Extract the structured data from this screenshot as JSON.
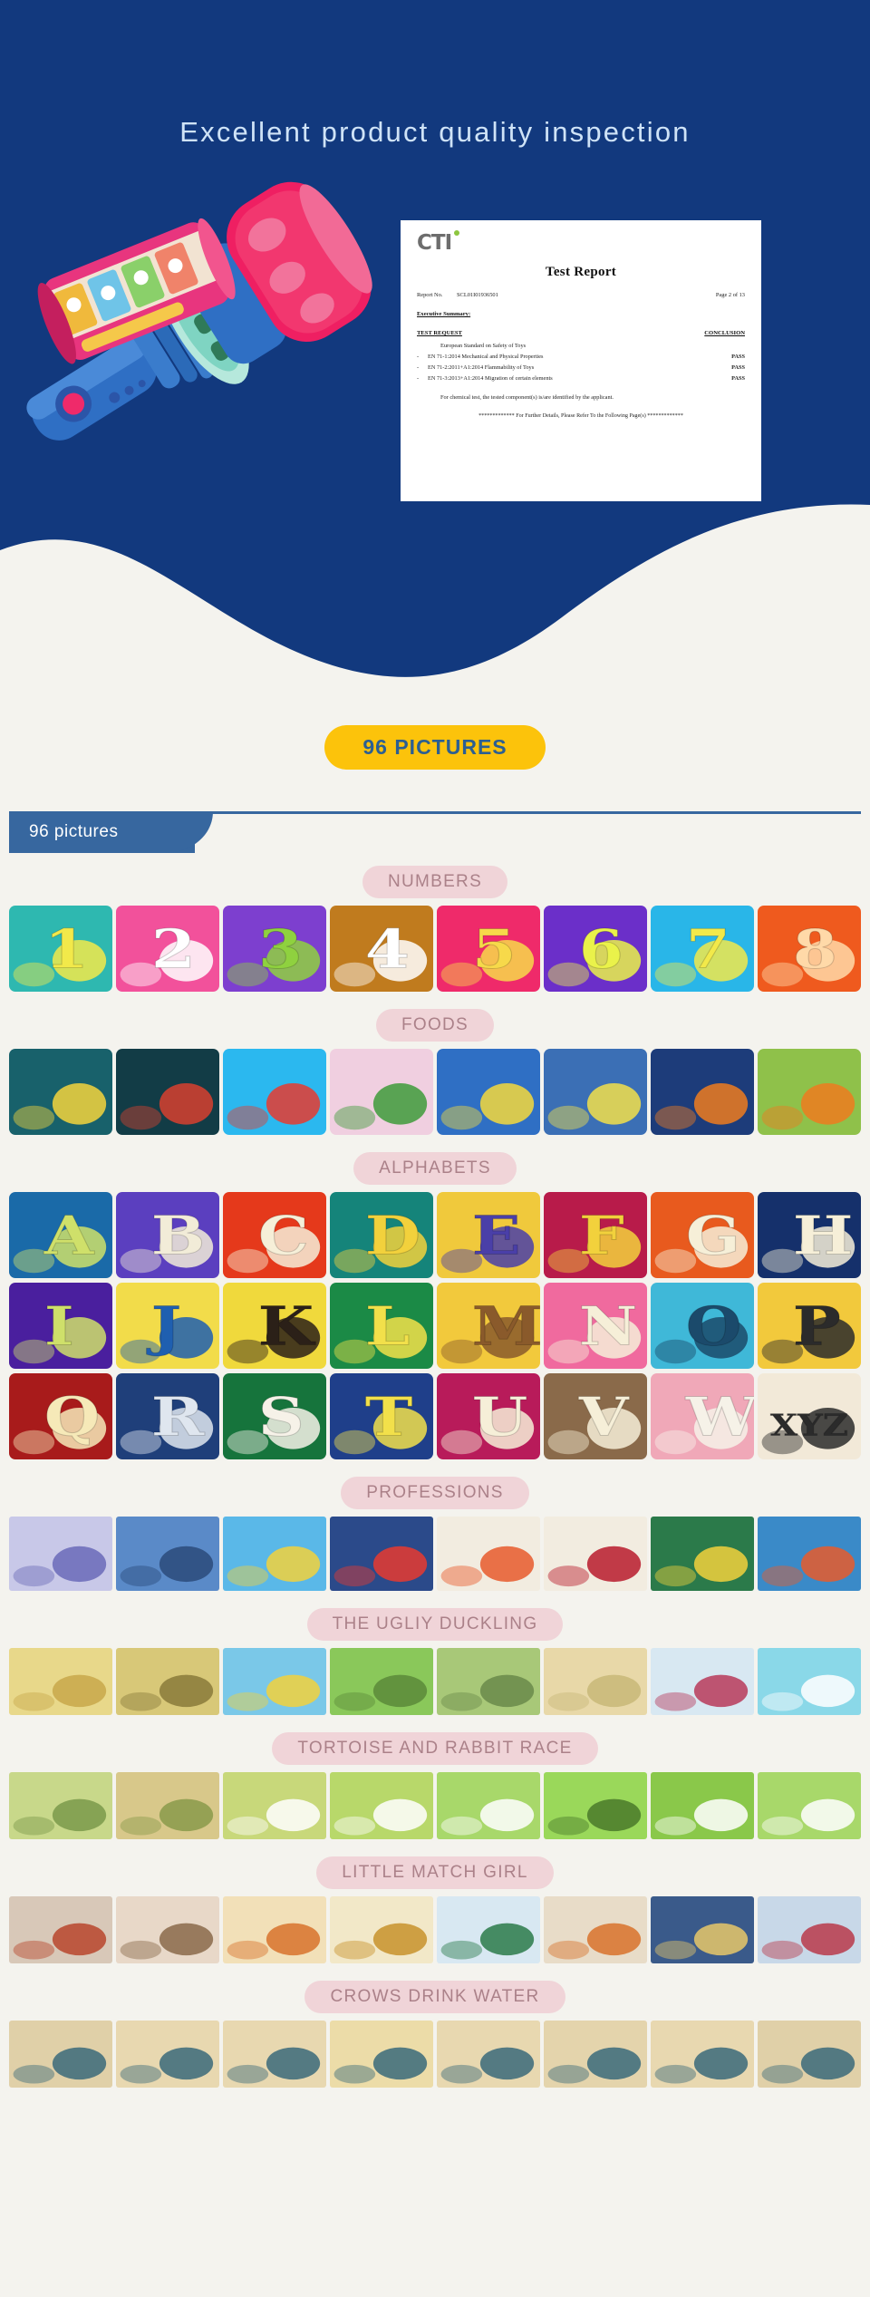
{
  "hero": {
    "title": "Excellent product quality inspection",
    "bg_color": "#12397e"
  },
  "report": {
    "logo": "CTI",
    "title": "Test Report",
    "report_no_label": "Report No.",
    "report_no_value": "SCL01I01936501",
    "page": "Page 2 of 13",
    "executive_summary_label": "Executive Summary:",
    "test_request_header": "TEST REQUEST",
    "conclusion_header": "CONCLUSION",
    "standard": "European Standard on Safety of Toys",
    "items": [
      {
        "dash": "-",
        "text": "EN 71-1:2014 Mechanical and Physical Properties",
        "result": "PASS"
      },
      {
        "dash": "-",
        "text": "EN 71-2:2011+A1:2014 Flammability of Toys",
        "result": "PASS"
      },
      {
        "dash": "-",
        "text": "EN 71-3:2013+A1:2014 Migration of certain elements",
        "result": "PASS"
      }
    ],
    "note": "For chemical test, the tested component(s) is/are identified by the applicant.",
    "footer": "************* For Further Details, Please Refer To the Following Page(s) *************"
  },
  "badge": {
    "label": "96  PICTURES",
    "bg_color": "#fcc30b",
    "text_color": "#2c5f92"
  },
  "tab": {
    "label": "96 pictures",
    "bg_color": "#37679f"
  },
  "sections": [
    {
      "label": "NUMBERS",
      "rows": [
        {
          "kind": "sq",
          "cells": [
            {
              "name": "number-card-1",
              "bg": "#2eb8b0",
              "fg": "#f2e94a",
              "glyph": "1"
            },
            {
              "name": "number-card-2",
              "bg": "#f2519b",
              "fg": "#ffffff",
              "glyph": "2"
            },
            {
              "name": "number-card-3",
              "bg": "#7d3fcf",
              "fg": "#8fd13f",
              "glyph": "3"
            },
            {
              "name": "number-card-4",
              "bg": "#c07b1e",
              "fg": "#ffffff",
              "glyph": "4"
            },
            {
              "name": "number-card-5",
              "bg": "#ef2a6a",
              "fg": "#f7d94a",
              "glyph": "5"
            },
            {
              "name": "number-card-6",
              "bg": "#6b2fc9",
              "fg": "#eaf24a",
              "glyph": "6"
            },
            {
              "name": "number-card-7",
              "bg": "#29b6e8",
              "fg": "#f2e94a",
              "glyph": "7"
            },
            {
              "name": "number-card-8",
              "bg": "#ef5a1e",
              "fg": "#ffd9a8",
              "glyph": "8"
            }
          ]
        }
      ]
    },
    {
      "label": "FOODS",
      "rows": [
        {
          "kind": "sq",
          "cells": [
            {
              "name": "food-card-pineapple",
              "bg": "#18616b",
              "fg": "#f5d53c",
              "glyph": ""
            },
            {
              "name": "food-card-apple",
              "bg": "#123c46",
              "fg": "#d8402f",
              "glyph": ""
            },
            {
              "name": "food-card-strawberry",
              "bg": "#2bb8ef",
              "fg": "#e8392f",
              "glyph": ""
            },
            {
              "name": "food-card-watermelon",
              "bg": "#f0cfe0",
              "fg": "#3e9b3a",
              "glyph": ""
            },
            {
              "name": "food-card-banana",
              "bg": "#2f6fc4",
              "fg": "#f5d93c",
              "glyph": ""
            },
            {
              "name": "food-card-lemon",
              "bg": "#3b6fb5",
              "fg": "#f3e04a",
              "glyph": ""
            },
            {
              "name": "food-card-pumpkin",
              "bg": "#1d3c7a",
              "fg": "#ef7b1e",
              "glyph": ""
            },
            {
              "name": "food-card-carrot",
              "bg": "#8fc14a",
              "fg": "#ef7b1e",
              "glyph": ""
            }
          ]
        }
      ]
    },
    {
      "label": "ALPHABETS",
      "rows": [
        {
          "kind": "sq",
          "cells": [
            {
              "name": "alphabet-card-a",
              "bg": "#1a6aa8",
              "fg": "#cfe06a",
              "glyph": "A"
            },
            {
              "name": "alphabet-card-b",
              "bg": "#5b3fbf",
              "fg": "#f2ecd8",
              "glyph": "B"
            },
            {
              "name": "alphabet-card-c",
              "bg": "#e5391b",
              "fg": "#f6efd8",
              "glyph": "C"
            },
            {
              "name": "alphabet-card-d",
              "bg": "#15847a",
              "fg": "#f2d13c",
              "glyph": "D"
            },
            {
              "name": "alphabet-card-e",
              "bg": "#f0c93c",
              "fg": "#4a3fa8",
              "glyph": "E"
            },
            {
              "name": "alphabet-card-f",
              "bg": "#b81b4a",
              "fg": "#f2d13c",
              "glyph": "F"
            },
            {
              "name": "alphabet-card-g",
              "bg": "#e85a1e",
              "fg": "#f6efd8",
              "glyph": "G"
            },
            {
              "name": "alphabet-card-h",
              "bg": "#15306b",
              "fg": "#f6efd8",
              "glyph": "H"
            }
          ]
        },
        {
          "kind": "sq",
          "cells": [
            {
              "name": "alphabet-card-i",
              "bg": "#4a1f9e",
              "fg": "#cfe06a",
              "glyph": "I"
            },
            {
              "name": "alphabet-card-j",
              "bg": "#f2dc4a",
              "fg": "#1f5fb0",
              "glyph": "J"
            },
            {
              "name": "alphabet-card-k",
              "bg": "#f0d93c",
              "fg": "#2b2018",
              "glyph": "K"
            },
            {
              "name": "alphabet-card-l",
              "bg": "#1b8a46",
              "fg": "#f2e04a",
              "glyph": "L"
            },
            {
              "name": "alphabet-card-m",
              "bg": "#f2c93c",
              "fg": "#8a5a2b",
              "glyph": "M"
            },
            {
              "name": "alphabet-card-n",
              "bg": "#f06a9e",
              "fg": "#f6efd8",
              "glyph": "N"
            },
            {
              "name": "alphabet-card-o",
              "bg": "#3fb8d8",
              "fg": "#1b4a6b",
              "glyph": "O"
            },
            {
              "name": "alphabet-card-p",
              "bg": "#f2c93c",
              "fg": "#2b2b2b",
              "glyph": "P"
            }
          ]
        },
        {
          "kind": "sq",
          "cells": [
            {
              "name": "alphabet-card-q",
              "bg": "#a81b1b",
              "fg": "#f6e9b8",
              "glyph": "Q"
            },
            {
              "name": "alphabet-card-r",
              "bg": "#1f3f7a",
              "fg": "#dfe6ef",
              "glyph": "R"
            },
            {
              "name": "alphabet-card-s",
              "bg": "#16743c",
              "fg": "#f6f2e8",
              "glyph": "S"
            },
            {
              "name": "alphabet-card-t",
              "bg": "#1f3f8a",
              "fg": "#f2e04a",
              "glyph": "T"
            },
            {
              "name": "alphabet-card-u",
              "bg": "#b81b5a",
              "fg": "#f6efd8",
              "glyph": "U"
            },
            {
              "name": "alphabet-card-v",
              "bg": "#8a6a4a",
              "fg": "#f6efd8",
              "glyph": "V"
            },
            {
              "name": "alphabet-card-w",
              "bg": "#f0a8b8",
              "fg": "#f6f2e8",
              "glyph": "W"
            },
            {
              "name": "alphabet-card-xyz",
              "bg": "#f2e9d8",
              "fg": "#2b2b2b",
              "glyph": "XYZ"
            }
          ]
        }
      ]
    },
    {
      "label": "PROFESSIONS",
      "rows": [
        {
          "kind": "wide",
          "cells": [
            {
              "name": "profession-card-teacher",
              "bg": "#c8c8e8",
              "fg": "#6a6ab8",
              "glyph": ""
            },
            {
              "name": "profession-card-police",
              "bg": "#5a8ac8",
              "fg": "#2b4a7a",
              "glyph": ""
            },
            {
              "name": "profession-card-traffic",
              "bg": "#5ab8e8",
              "fg": "#f2d13c",
              "glyph": ""
            },
            {
              "name": "profession-card-firefighter",
              "bg": "#2b4a8a",
              "fg": "#e8392f",
              "glyph": ""
            },
            {
              "name": "profession-card-tutor",
              "bg": "#f2ece0",
              "fg": "#e85a2b",
              "glyph": ""
            },
            {
              "name": "profession-card-chef",
              "bg": "#f2ece0",
              "fg": "#b81b2b",
              "glyph": ""
            },
            {
              "name": "profession-card-athlete",
              "bg": "#2b7a4a",
              "fg": "#f2d13c",
              "glyph": ""
            },
            {
              "name": "profession-card-musician",
              "bg": "#3a8ac8",
              "fg": "#e85a2b",
              "glyph": ""
            }
          ]
        }
      ]
    },
    {
      "label": "THE UGLIY DUCKLING",
      "rows": [
        {
          "kind": "wide8",
          "cells": [
            {
              "name": "story-duckling-1",
              "bg": "#e8d88a",
              "fg": "#c8a84a",
              "glyph": ""
            },
            {
              "name": "story-duckling-2",
              "bg": "#d8c878",
              "fg": "#8a7a3a",
              "glyph": ""
            },
            {
              "name": "story-duckling-3",
              "bg": "#7ac8e8",
              "fg": "#f2d13c",
              "glyph": ""
            },
            {
              "name": "story-duckling-4",
              "bg": "#8ac85a",
              "fg": "#5a8a3a",
              "glyph": ""
            },
            {
              "name": "story-duckling-5",
              "bg": "#a8c878",
              "fg": "#6a8a4a",
              "glyph": ""
            },
            {
              "name": "story-duckling-6",
              "bg": "#e8d8a8",
              "fg": "#c8b878",
              "glyph": ""
            },
            {
              "name": "story-duckling-7",
              "bg": "#d8e8f2",
              "fg": "#b83a5a",
              "glyph": ""
            },
            {
              "name": "story-duckling-8",
              "bg": "#8ad8e8",
              "fg": "#ffffff",
              "glyph": ""
            }
          ]
        }
      ]
    },
    {
      "label": "TORTOISE AND  RABBIT RACE",
      "rows": [
        {
          "kind": "wide8",
          "cells": [
            {
              "name": "story-tortoise-1",
              "bg": "#c8d88a",
              "fg": "#7a9a4a",
              "glyph": ""
            },
            {
              "name": "story-tortoise-2",
              "bg": "#d8c88a",
              "fg": "#8a9a4a",
              "glyph": ""
            },
            {
              "name": "story-tortoise-3",
              "bg": "#c8d87a",
              "fg": "#ffffff",
              "glyph": ""
            },
            {
              "name": "story-tortoise-4",
              "bg": "#b8d86a",
              "fg": "#ffffff",
              "glyph": ""
            },
            {
              "name": "story-tortoise-5",
              "bg": "#a8d86a",
              "fg": "#ffffff",
              "glyph": ""
            },
            {
              "name": "story-tortoise-6",
              "bg": "#9ad85a",
              "fg": "#4a7a2a",
              "glyph": ""
            },
            {
              "name": "story-tortoise-7",
              "bg": "#8ac84a",
              "fg": "#ffffff",
              "glyph": ""
            },
            {
              "name": "story-tortoise-8",
              "bg": "#a8d86a",
              "fg": "#ffffff",
              "glyph": ""
            }
          ]
        }
      ]
    },
    {
      "label": "LITTLE MATCH GIRL",
      "rows": [
        {
          "kind": "wide8",
          "cells": [
            {
              "name": "story-matchgirl-1",
              "bg": "#d8c8b8",
              "fg": "#b8452b",
              "glyph": ""
            },
            {
              "name": "story-matchgirl-2",
              "bg": "#e8d8c8",
              "fg": "#8a6a4a",
              "glyph": ""
            },
            {
              "name": "story-matchgirl-3",
              "bg": "#f2e0b8",
              "fg": "#d8722b",
              "glyph": ""
            },
            {
              "name": "story-matchgirl-4",
              "bg": "#f2e8c8",
              "fg": "#c8922b",
              "glyph": ""
            },
            {
              "name": "story-matchgirl-5",
              "bg": "#d8e8f2",
              "fg": "#2b7a4a",
              "glyph": ""
            },
            {
              "name": "story-matchgirl-6",
              "bg": "#e8dcc8",
              "fg": "#d8722b",
              "glyph": ""
            },
            {
              "name": "story-matchgirl-7",
              "bg": "#3a5a8a",
              "fg": "#e8c868",
              "glyph": ""
            },
            {
              "name": "story-matchgirl-8",
              "bg": "#c8d8e8",
              "fg": "#b83a4a",
              "glyph": ""
            }
          ]
        }
      ]
    },
    {
      "label": "CROWS DRINK WATER",
      "rows": [
        {
          "kind": "wide8",
          "cells": [
            {
              "name": "story-crow-1",
              "bg": "#e0d0a8",
              "fg": "#3a6a7a",
              "glyph": ""
            },
            {
              "name": "story-crow-2",
              "bg": "#e8d8b0",
              "fg": "#3a6a7a",
              "glyph": ""
            },
            {
              "name": "story-crow-3",
              "bg": "#e8d8b0",
              "fg": "#3a6a7a",
              "glyph": ""
            },
            {
              "name": "story-crow-4",
              "bg": "#ecdca8",
              "fg": "#3a6a7a",
              "glyph": ""
            },
            {
              "name": "story-crow-5",
              "bg": "#e8d8b0",
              "fg": "#3a6a7a",
              "glyph": ""
            },
            {
              "name": "story-crow-6",
              "bg": "#e4d4ac",
              "fg": "#3a6a7a",
              "glyph": ""
            },
            {
              "name": "story-crow-7",
              "bg": "#e8d8b0",
              "fg": "#3a6a7a",
              "glyph": ""
            },
            {
              "name": "story-crow-8",
              "bg": "#e0d0a8",
              "fg": "#3a6a7a",
              "glyph": ""
            }
          ]
        }
      ]
    }
  ]
}
